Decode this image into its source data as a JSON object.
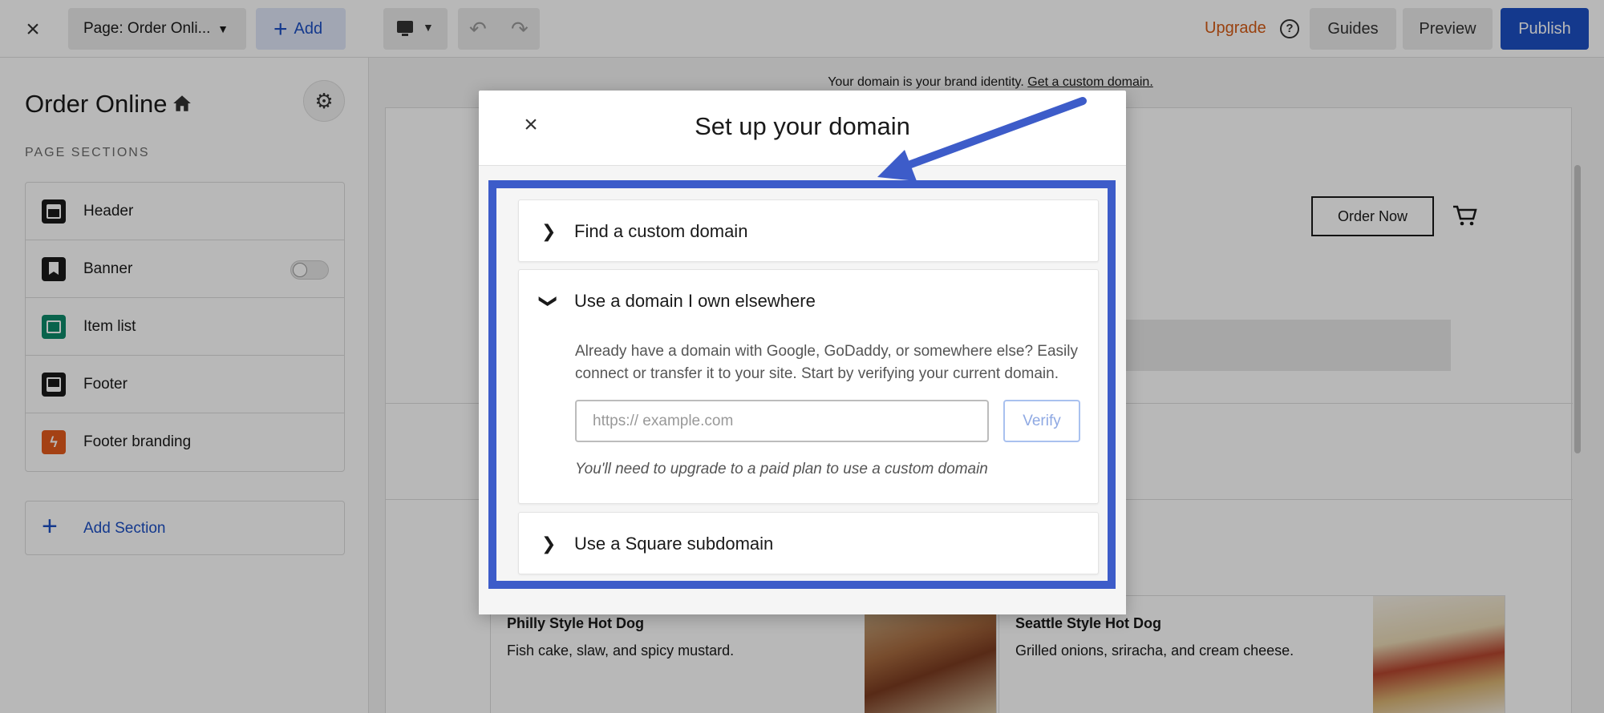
{
  "topbar": {
    "close_icon": "close-icon",
    "page_selector": "Page: Order Onli...",
    "add_label": "Add",
    "upgrade_label": "Upgrade",
    "help_icon": "?",
    "guides_label": "Guides",
    "preview_label": "Preview",
    "publish_label": "Publish"
  },
  "sidebar": {
    "title": "Order Online",
    "section_label": "PAGE SECTIONS",
    "items": [
      {
        "label": "Header",
        "icon": "header-icon"
      },
      {
        "label": "Banner",
        "icon": "banner-icon",
        "toggle": false
      },
      {
        "label": "Item list",
        "icon": "item-list-icon"
      },
      {
        "label": "Footer",
        "icon": "footer-icon"
      },
      {
        "label": "Footer branding",
        "icon": "lightning-icon"
      }
    ],
    "add_section_label": "Add Section"
  },
  "canvas": {
    "notice_text": "Your domain is your brand identity. ",
    "notice_link": "Get a custom domain.",
    "order_now_label": "Order Now",
    "products": [
      {
        "name": "Philly Style Hot Dog",
        "description": "Fish cake, slaw, and spicy mustard."
      },
      {
        "name": "Seattle Style Hot Dog",
        "description": "Grilled onions, sriracha, and cream cheese."
      }
    ]
  },
  "modal": {
    "title": "Set up your domain",
    "sections": [
      {
        "label": "Find a custom domain",
        "expanded": false
      },
      {
        "label": "Use a domain I own elsewhere",
        "expanded": true
      },
      {
        "label": "Use a Square subdomain",
        "expanded": false
      }
    ],
    "description": "Already have a domain with Google, GoDaddy, or somewhere else? Easily connect or transfer it to your site. Start by verifying your current domain.",
    "input_placeholder": "https://  example.com",
    "verify_label": "Verify",
    "note": "You'll need to upgrade to a paid plan to use a custom domain"
  },
  "colors": {
    "brand_blue": "#1c4fc4",
    "highlight_blue": "#3d5cc9",
    "upgrade_orange": "#d45b15"
  }
}
